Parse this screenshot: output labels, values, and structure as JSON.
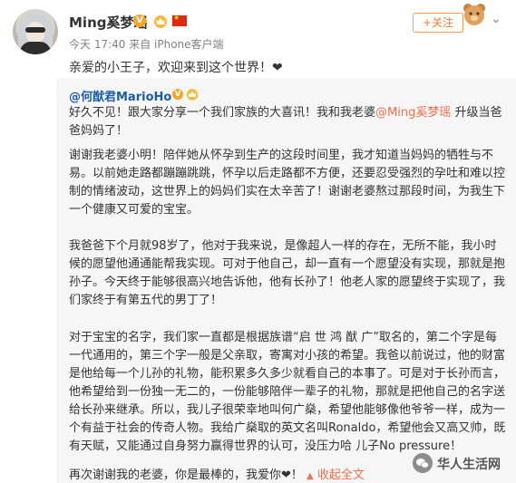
{
  "post": {
    "username": "Ming奚梦瑶",
    "verified_badge": "V",
    "meta": "今天 17:40 来自 iPhone客户端",
    "follow_label": "+关注",
    "chevron_icon": "chevron-down-icon",
    "text": "亲爱的小王子，欢迎来到这个世界！❤"
  },
  "repost": {
    "user": "@何猷君MarioHo",
    "verified_badge": "V",
    "p1_before": "好久不见！跟大家分享一个我们家族的大喜讯！我和我老婆",
    "p1_mention": "@Ming奚梦瑶",
    "p1_after": " 升级当爸爸妈妈了！",
    "p2": "谢谢我老婆小明！陪伴她从怀孕到生产的这段时间里，我才知道当妈妈的牺牲与不易。以前她走路都蹦蹦跳跳，怀孕以后走路都不方便，还要忍受强烈的孕吐和难以控制的情绪波动，这世界上的妈妈们实在太辛苦了！谢谢老婆熬过那段时间，为我生下一个健康又可爱的宝宝。",
    "p3": "我爸爸下个月就98岁了，他对于我来说，是像超人一样的存在，无所不能，我小时候的愿望他通通能帮我实现。可对于他自己，却一直有一个愿望没有实现，那就是抱孙子。今天终于能够很高兴地告诉他，他有长孙了！他老人家的愿望终于实现了，我们家终于有第五代的男丁了！",
    "p4": "对于宝宝的名字，我们家一直都是根据族谱“启 世 鸿 猷 广”取名的，第二个字是每一代通用的，第三个字一般是父亲取，寄寓对小孩的希望。我爸以前说过，他的财富是他给每一个儿孙的礼物，能积累多久多少就看自己的本事了。可是对于长孙而言，他希望给到一份独一无二的，一份能够陪伴一辈子的礼物，那就是把他自己的名字送给长孙来继承。所以，我儿子很荣幸地叫何广燊，希望他能够像他爷爷一样，成为一个有益于社会的传奇人物。我给广燊取的英文名叫Ronaldo，希望他会又高又帅，既有天赋，又能通过自身努力赢得世界的认可，没压力哈 儿子No pressure！",
    "p5_text": "再次谢谢我的老婆，你是最棒的，我爱你❤！ ",
    "collapse_label": "收起全文",
    "collapse_arrow": "▲"
  },
  "watermark": {
    "text": "华人生活网"
  },
  "colors": {
    "accent": "#eb7350",
    "link": "#1a5ea8",
    "follow": "#f27f2c",
    "repost_bg": "#f6f6f6"
  }
}
